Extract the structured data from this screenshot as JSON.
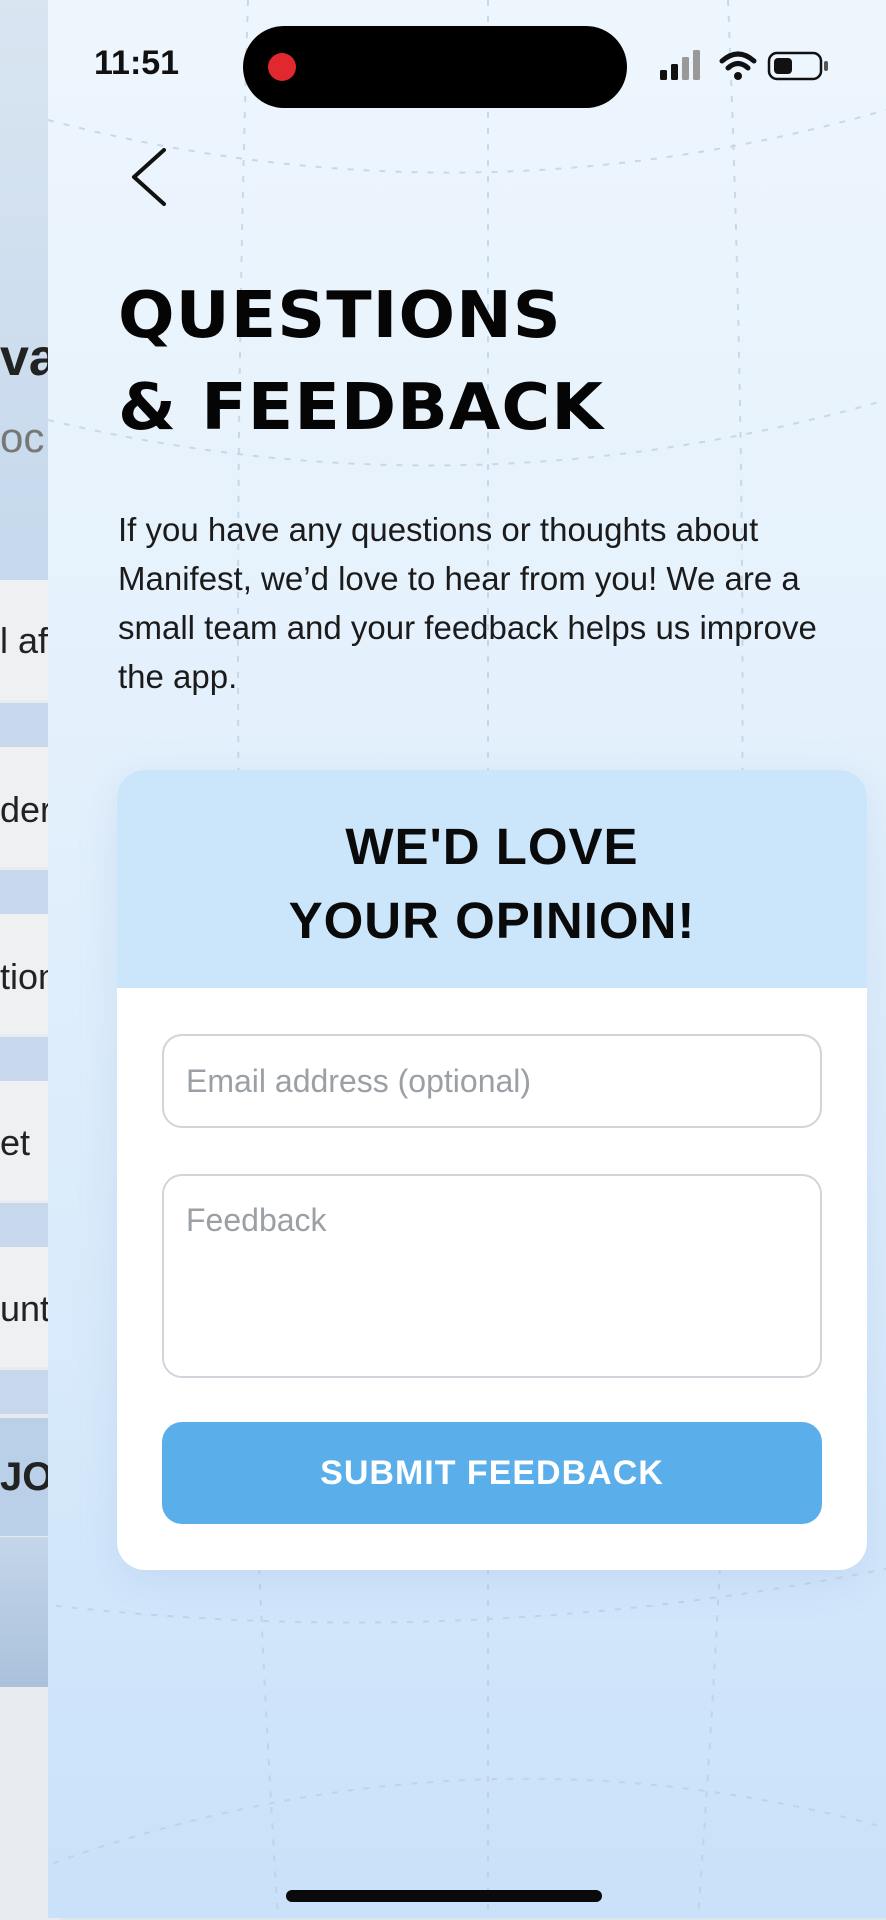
{
  "status_bar": {
    "time": "11:51"
  },
  "background_page": {
    "fragments": [
      "va",
      "oc",
      "l aff",
      "der",
      "tion",
      "et",
      "unt",
      "JOU"
    ]
  },
  "page": {
    "back_icon": "chevron-left-icon",
    "title_line1": "QUESTIONS",
    "title_line2": "& FEEDBACK",
    "intro": "If you have any questions or thoughts about Manifest, we’d love to hear from you! We are a small team and your feedback helps us improve the app."
  },
  "form": {
    "heading_line1": "WE'D LOVE",
    "heading_line2": "YOUR OPINION!",
    "email_placeholder": "Email address (optional)",
    "email_value": "",
    "feedback_placeholder": "Feedback",
    "feedback_value": "",
    "submit_label": "SUBMIT FEEDBACK"
  },
  "colors": {
    "accent": "#5aaeea",
    "card_header": "#cbe5fb",
    "record_dot": "#e0282e"
  }
}
